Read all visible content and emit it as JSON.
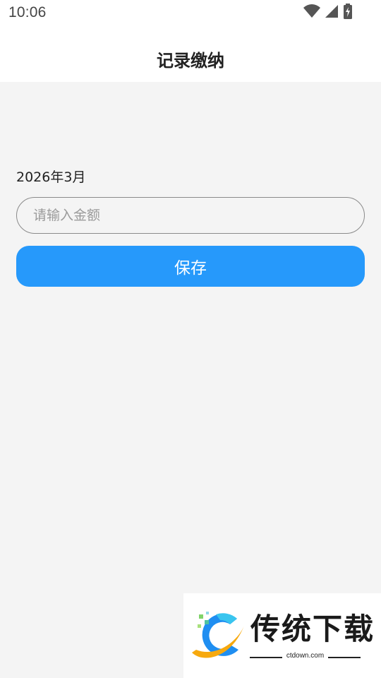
{
  "status_bar": {
    "time": "10:06",
    "icons": [
      "wifi-icon",
      "cellular-signal-icon",
      "battery-charging-icon"
    ]
  },
  "app_bar": {
    "title": "记录缴纳"
  },
  "form": {
    "month_label": "2026年3月",
    "amount_input": {
      "value": "",
      "placeholder": "请输入金额"
    },
    "save_label": "保存"
  },
  "watermark": {
    "brand_text": "传统下载",
    "url": "ctdown.com"
  },
  "colors": {
    "primary": "#2699fb",
    "background": "#f4f4f4",
    "surface": "#ffffff",
    "input_border": "#8a8a8a",
    "placeholder": "#9a9a9a"
  }
}
